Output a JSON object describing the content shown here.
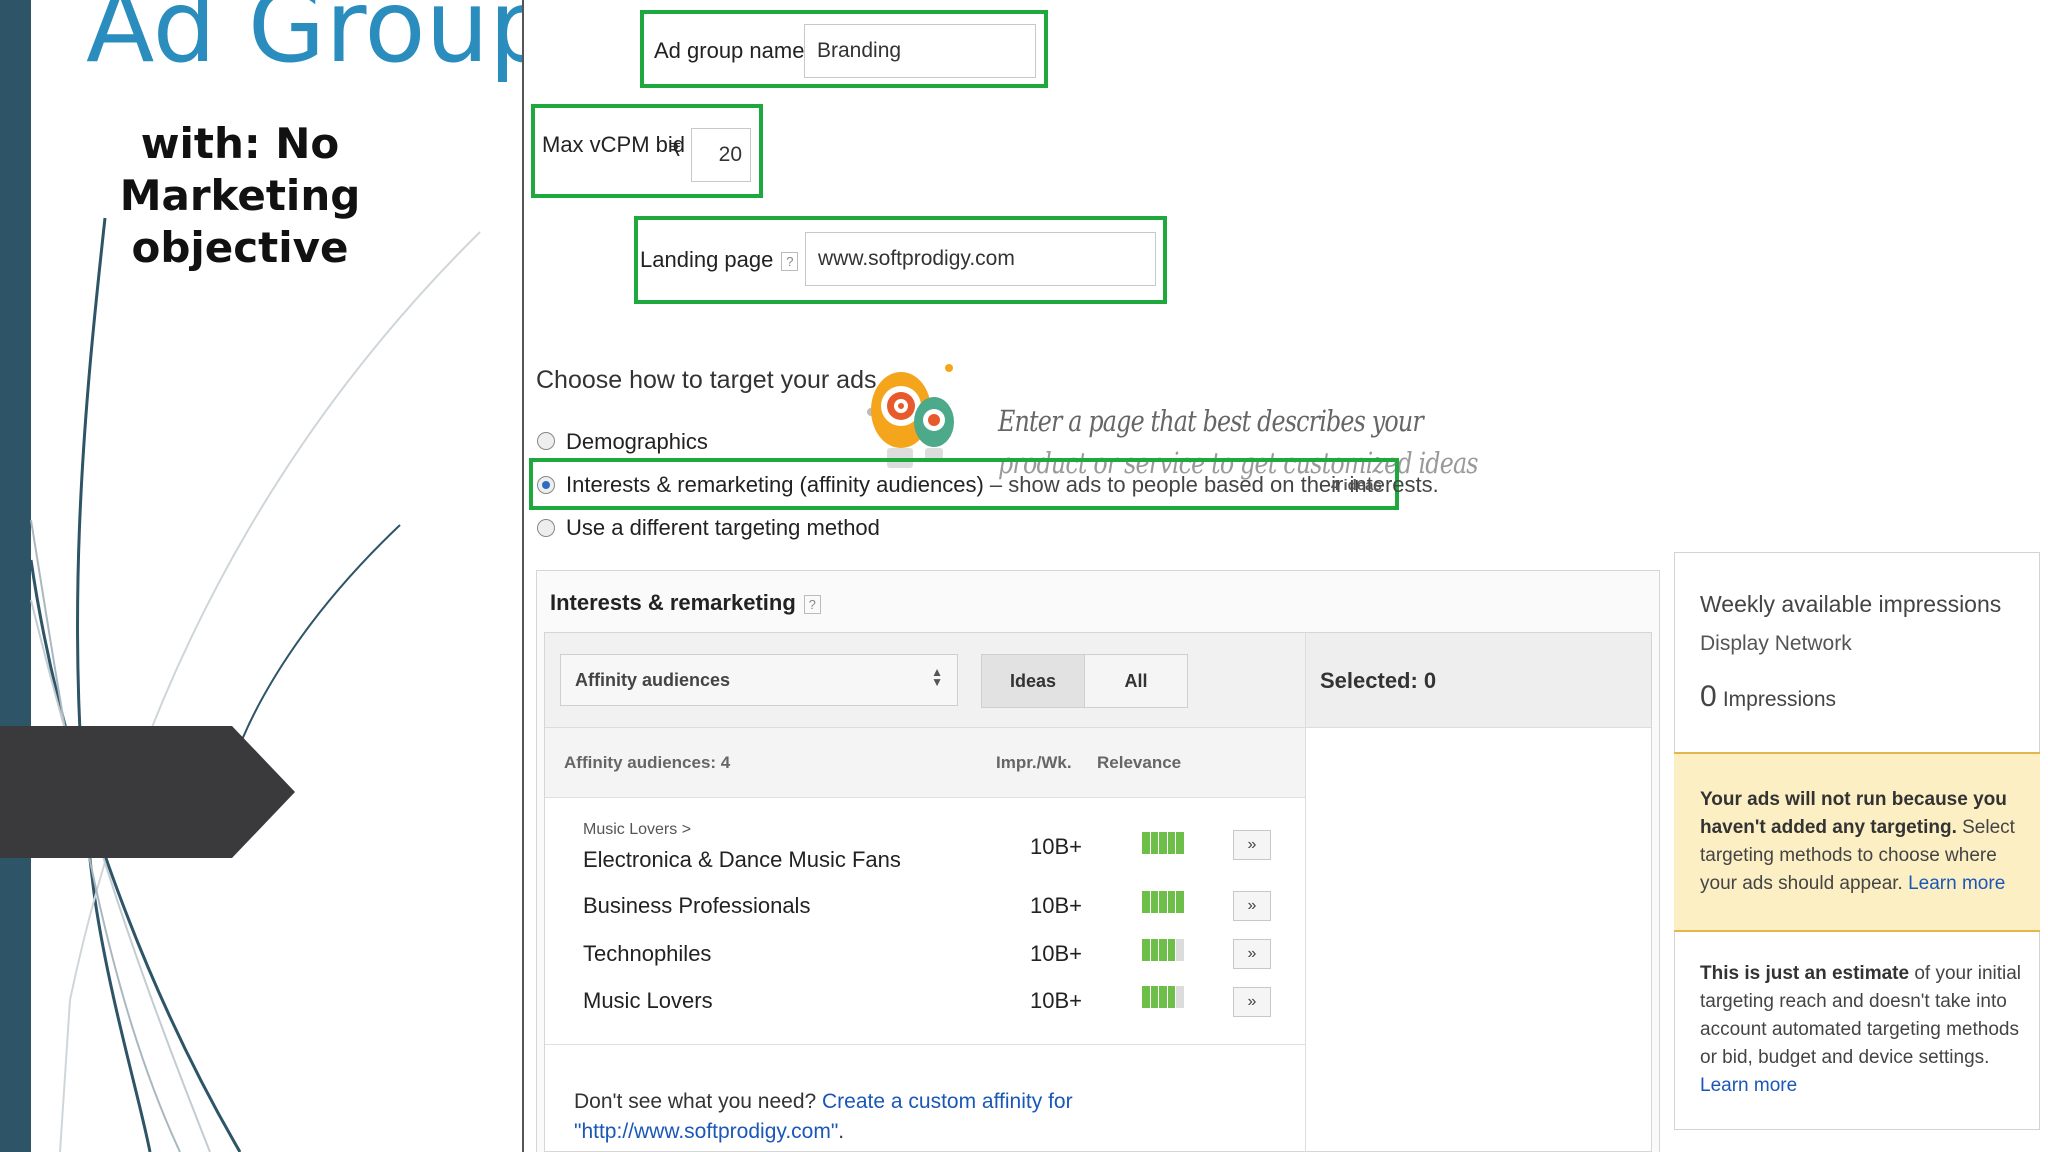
{
  "slide": {
    "title": "Ad Group",
    "subtitle": "with: No Marketing objective"
  },
  "form": {
    "ad_group_name_label": "Ad group name",
    "ad_group_name_value": "Branding",
    "max_vcpm_label": "Max vCPM bid",
    "currency_symbol": "₹",
    "max_vcpm_value": "20",
    "landing_page_label": "Landing page",
    "help_glyph": "?",
    "landing_page_value": "www.softprodigy.com",
    "targeting_heading": "Choose how to target your ads",
    "overlay_hint_line1": "Enter a page that best describes your",
    "overlay_hint_line2": "product or service to get customized ideas",
    "options": [
      {
        "label": "Demographics",
        "selected": false
      },
      {
        "label": "Interests & remarketing (affinity audiences)",
        "suffix": " – show ads to people based on their interests.",
        "badge": "4 ideas",
        "selected": true
      },
      {
        "label": "Use a different targeting method",
        "selected": false
      }
    ]
  },
  "interests_panel": {
    "title": "Interests & remarketing",
    "dropdown_value": "Affinity audiences",
    "toggle_ideas": "Ideas",
    "toggle_all": "All",
    "selected_label": "Selected: 0",
    "list_header": "Affinity audiences: 4",
    "col_impr": "Impr./Wk.",
    "col_relevance": "Relevance",
    "add_glyph": "»",
    "rows": [
      {
        "parent": "Music Lovers >",
        "name": "Electronica & Dance Music Fans",
        "impr": "10B+",
        "relevance": 5
      },
      {
        "parent": "",
        "name": "Business Professionals",
        "impr": "10B+",
        "relevance": 5
      },
      {
        "parent": "",
        "name": "Technophiles",
        "impr": "10B+",
        "relevance": 4
      },
      {
        "parent": "",
        "name": "Music Lovers",
        "impr": "10B+",
        "relevance": 4
      }
    ],
    "footer_prefix": "Don't see what you need? ",
    "footer_link": "Create a custom affinity for",
    "footer_link2": "\"http://www.softprodigy.com\"",
    "footer_end": "."
  },
  "side_panel": {
    "weekly_title": "Weekly available impressions",
    "network": "Display Network",
    "impressions_count": "0",
    "impressions_label": "Impressions",
    "warning_bold": "Your ads will not run because you haven't added any targeting.",
    "warning_rest": " Select targeting methods to choose where your ads should appear. ",
    "learn_more": "Learn more",
    "estimate_bold": "This is just an estimate",
    "estimate_rest": " of your initial targeting reach and doesn't take into account automated targeting methods or bid, budget and device settings.",
    "learn_more_2": "Learn more"
  },
  "colors": {
    "highlight_green": "#1fa83e",
    "slide_title_blue": "#2a8dbd",
    "slide_stripe": "#2e5468",
    "warning_bg": "#fcefc4",
    "link_blue": "#1a57b8",
    "relevance_green": "#6dbf4a"
  }
}
